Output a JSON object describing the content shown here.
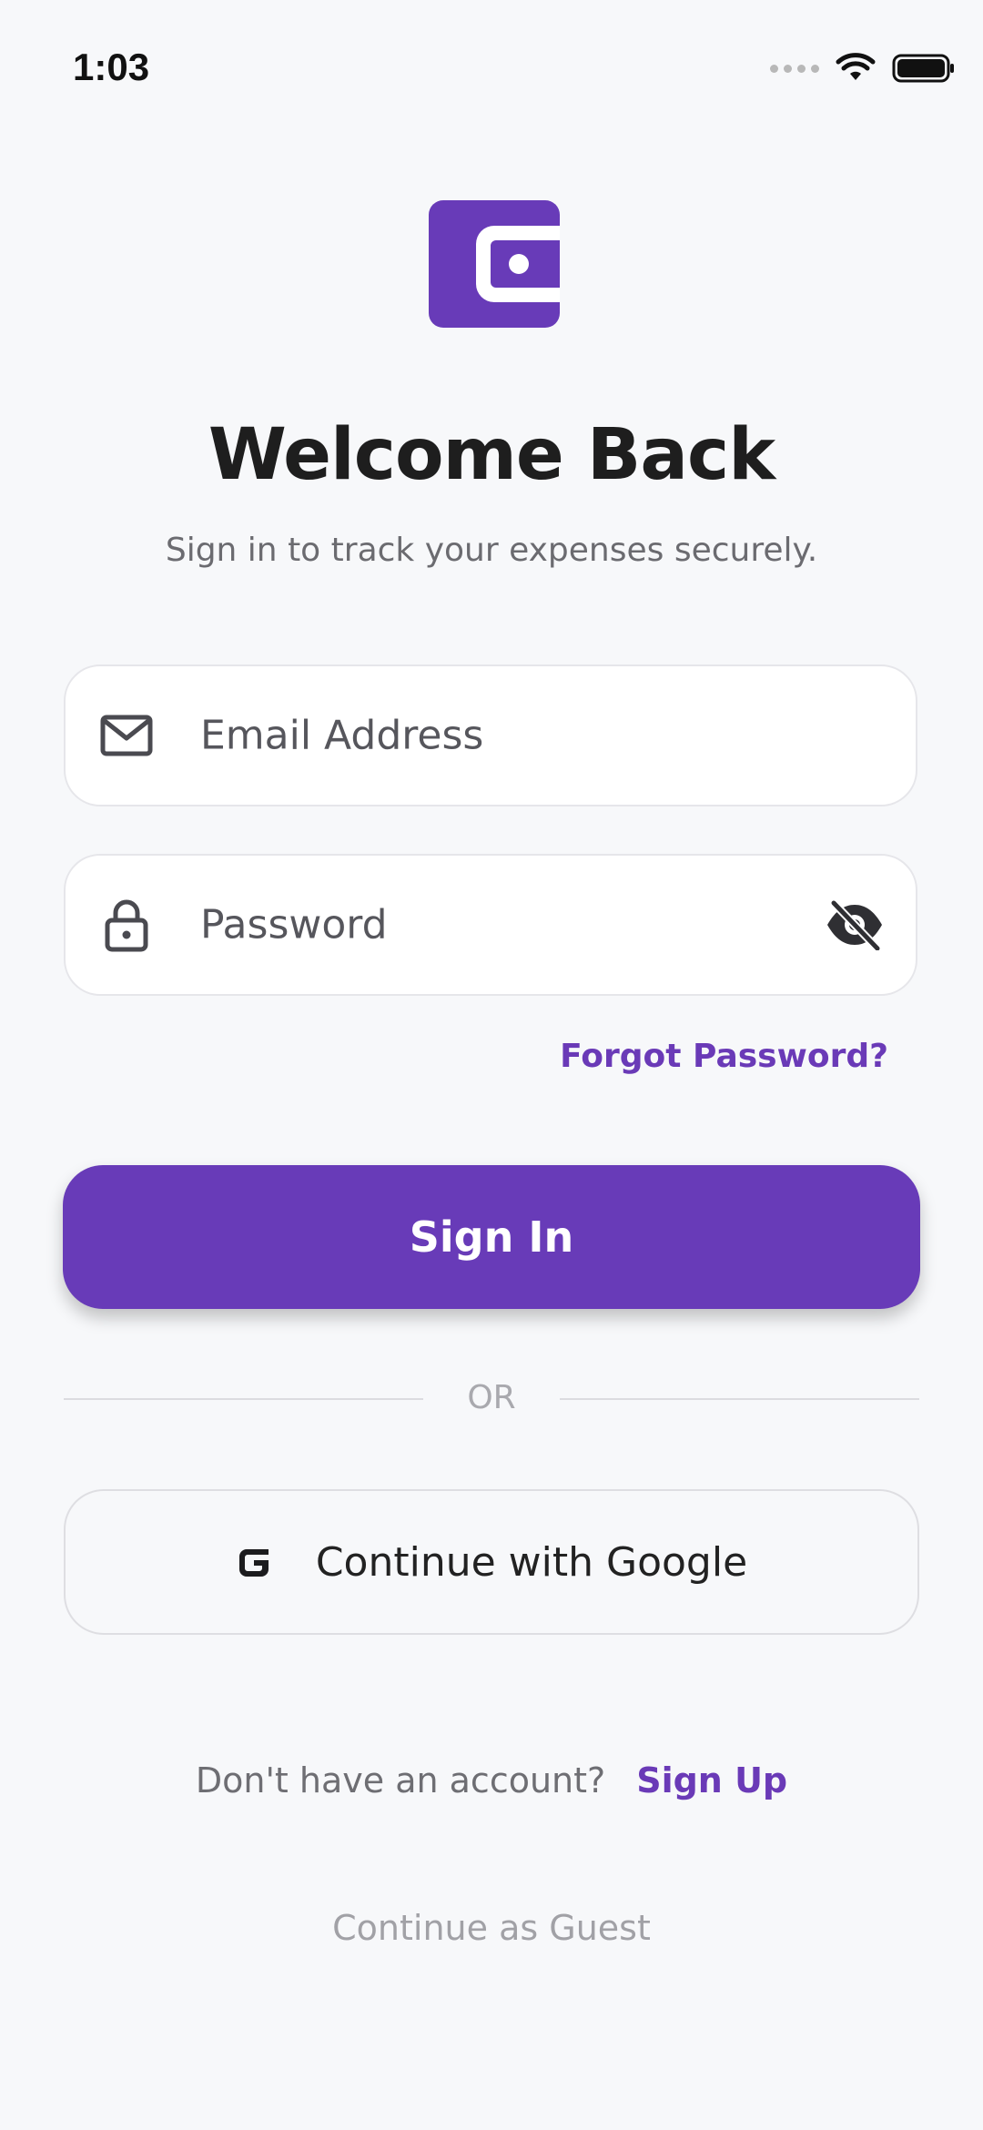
{
  "status_bar": {
    "time": "1:03"
  },
  "brand": {
    "accent": "#683bb8",
    "logo_icon": "wallet-icon"
  },
  "header": {
    "title": "Welcome Back",
    "subtitle": "Sign in to track your expenses securely."
  },
  "form": {
    "email_placeholder": "Email Address",
    "email_icon": "mail-icon",
    "password_placeholder": "Password",
    "password_icon": "lock-icon",
    "password_toggle_icon": "eye-off-icon",
    "forgot_label": "Forgot Password?",
    "signin_label": "Sign In"
  },
  "divider": {
    "label": "OR"
  },
  "social": {
    "google_label": "Continue with Google",
    "google_icon": "google-icon"
  },
  "footer": {
    "signup_prompt": "Don't have an account?",
    "signup_label": "Sign Up",
    "guest_label": "Continue as Guest"
  }
}
